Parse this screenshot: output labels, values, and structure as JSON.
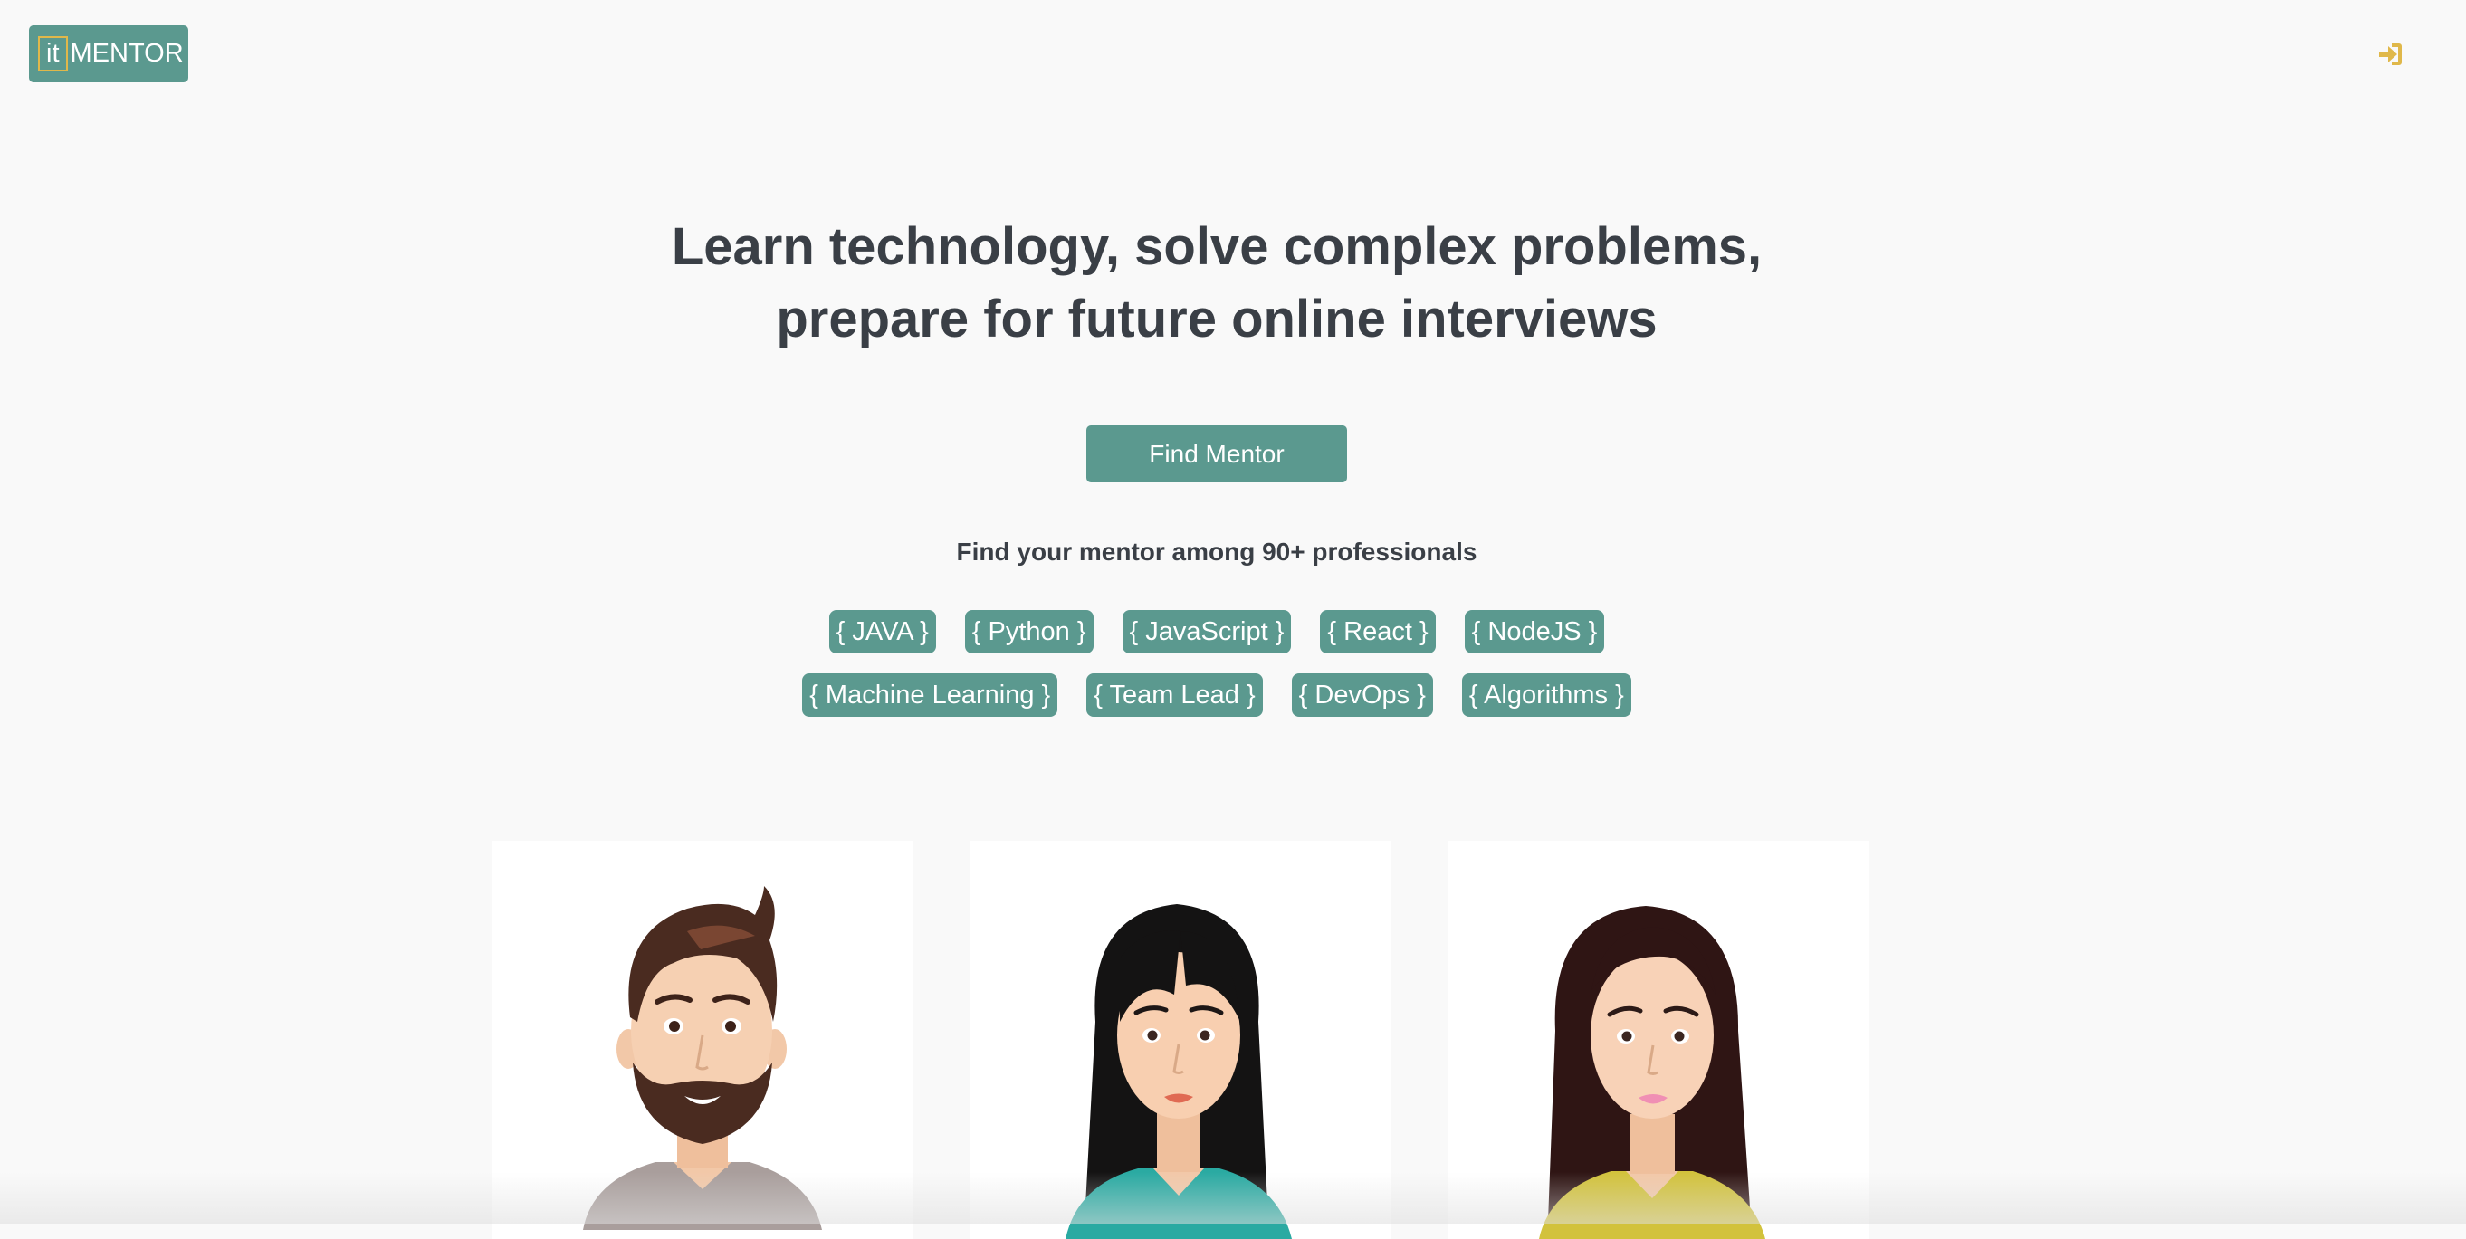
{
  "header": {
    "logo_it": "it",
    "logo_text": "MENTOR",
    "signin_icon": "sign-in-icon",
    "accent_color": "#e0b84a",
    "brand_color": "#5b998f"
  },
  "hero": {
    "title_line1": "Learn technology, solve complex problems,",
    "title_line2": "prepare for future online interviews",
    "cta_label": "Find Mentor",
    "subtitle": "Find your mentor among 90+ professionals"
  },
  "tags": {
    "row1": [
      "{ JAVA }",
      "{ Python }",
      "{ JavaScript }",
      "{ React }",
      "{ NodeJS }"
    ],
    "row2": [
      "{ Machine Learning }",
      "{ Team Lead }",
      "{ DevOps }",
      "{ Algorithms }"
    ]
  },
  "mentors": [
    {
      "avatar": "bearded-man-avatar"
    },
    {
      "avatar": "woman-dark-hair-avatar"
    },
    {
      "avatar": "woman-brown-hair-avatar"
    }
  ]
}
